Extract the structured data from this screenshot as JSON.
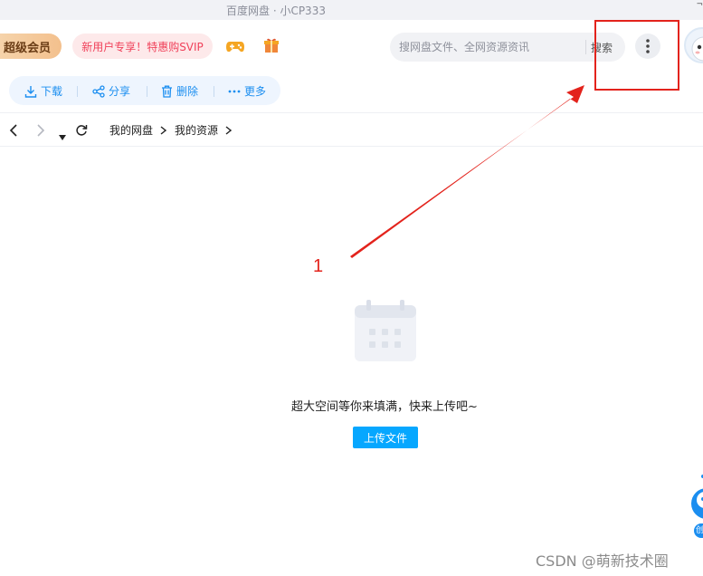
{
  "window": {
    "title": "百度网盘 · 小CP333",
    "corner_glyph": "¬"
  },
  "header": {
    "vip_label": "超级会员",
    "promo_label": "新用户专享！特惠购SVIP",
    "search": {
      "placeholder": "搜网盘文件、全网资源资讯",
      "value": "",
      "button_label": "搜索"
    }
  },
  "toolbar": {
    "download_label": "下载",
    "share_label": "分享",
    "delete_label": "删除",
    "more_label": "更多"
  },
  "breadcrumb": {
    "items": [
      "我的网盘",
      "我的资源"
    ]
  },
  "annotation": {
    "number": "1"
  },
  "empty_state": {
    "message": "超大空间等你来填满，快来上传吧~",
    "upload_label": "上传文件"
  },
  "assistant": {
    "label": "创"
  },
  "watermark": "CSDN @萌新技术圈",
  "colors": {
    "accent": "#06a7ff",
    "toolbar_text": "#1b8ef0",
    "annotation": "#e3231c",
    "promo_text": "#f0415a"
  }
}
